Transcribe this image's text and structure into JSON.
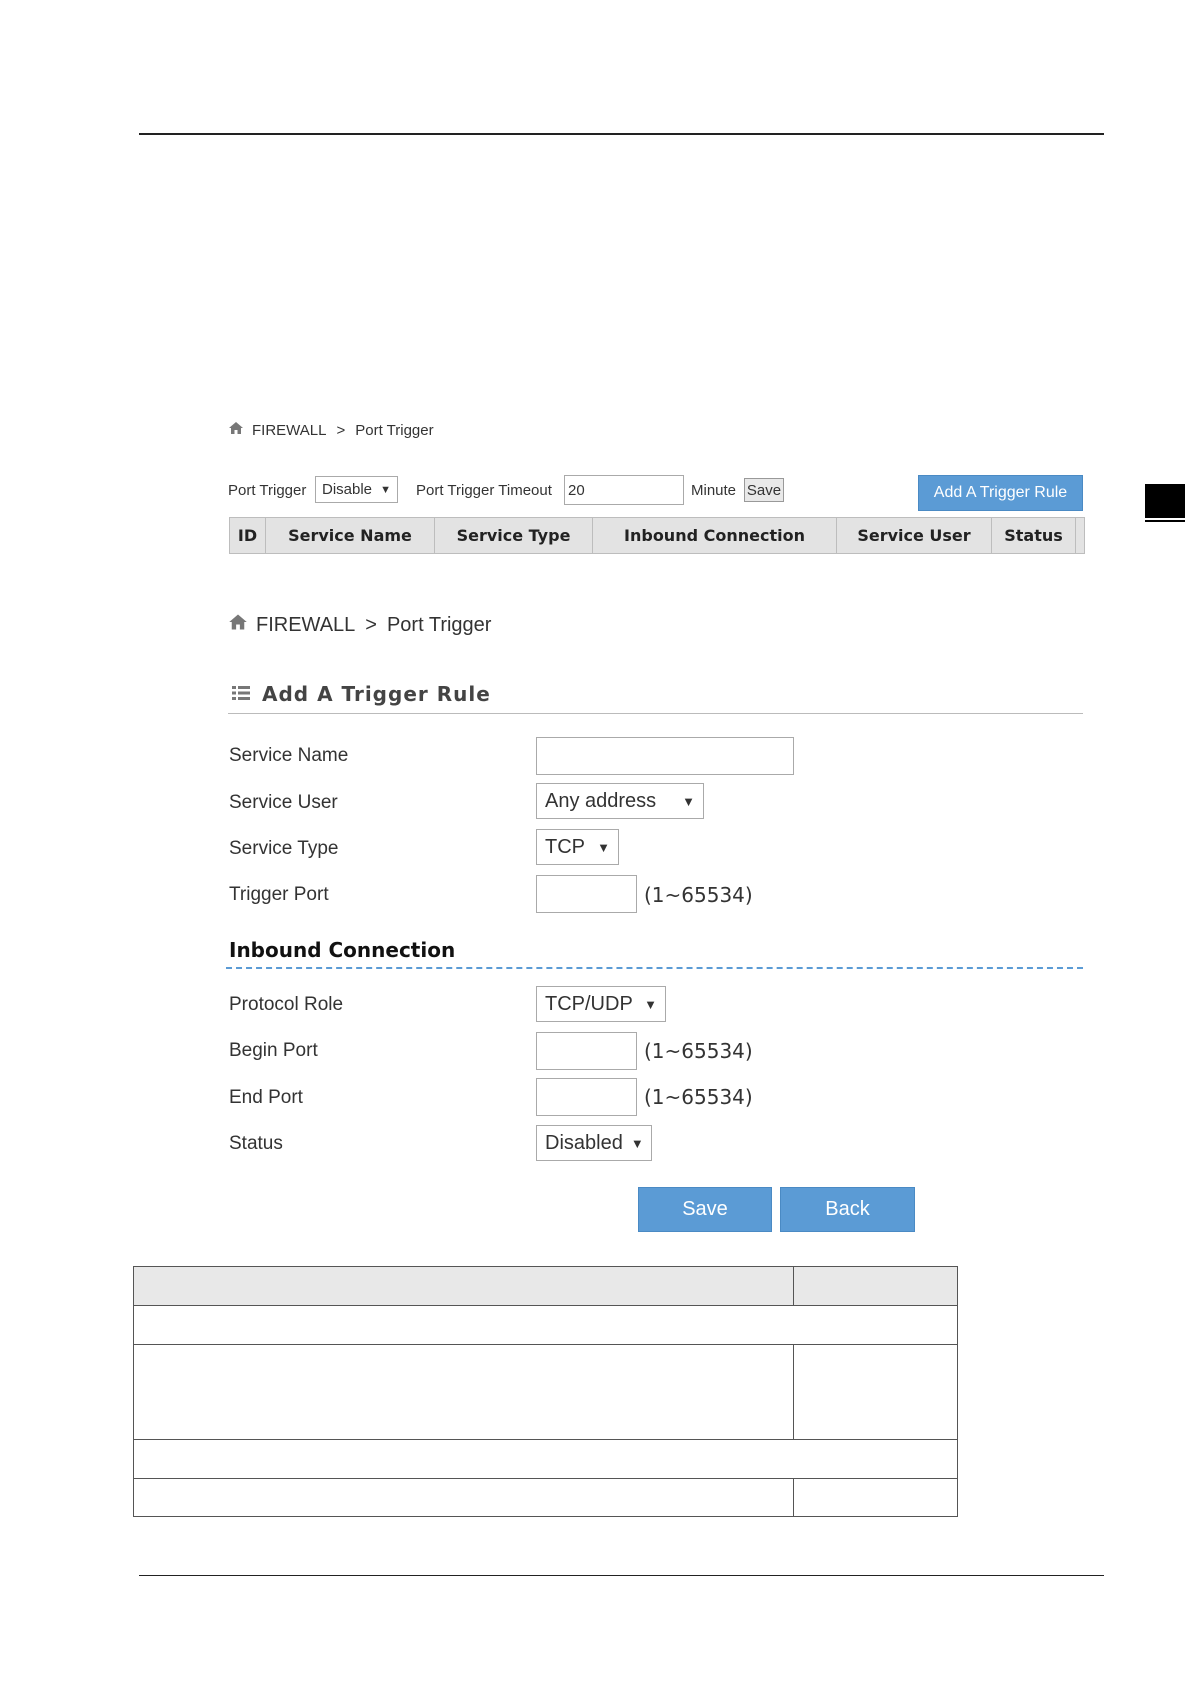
{
  "breadcrumb_small": {
    "section": "FIREWALL",
    "separator": ">",
    "page": "Port Trigger"
  },
  "toolbar": {
    "port_trigger_label": "Port Trigger",
    "port_trigger_value": "Disable",
    "timeout_label": "Port Trigger Timeout",
    "timeout_value": "20",
    "minute_label": "Minute",
    "save_label": "Save",
    "add_rule_label": "Add A Trigger Rule"
  },
  "table_headers": [
    "ID",
    "Service Name",
    "Service Type",
    "Inbound Connection",
    "Service User",
    "Status"
  ],
  "breadcrumb_large": {
    "section": "FIREWALL",
    "separator": ">",
    "page": "Port Trigger"
  },
  "form": {
    "title": "Add A Trigger Rule",
    "service_name_label": "Service Name",
    "service_name_value": "",
    "service_user_label": "Service User",
    "service_user_value": "Any address",
    "service_type_label": "Service Type",
    "service_type_value": "TCP",
    "trigger_port_label": "Trigger Port",
    "trigger_port_range": "(1~65534)",
    "inbound_title": "Inbound Connection",
    "protocol_role_label": "Protocol Role",
    "protocol_role_value": "TCP/UDP",
    "begin_port_label": "Begin Port",
    "begin_port_range": "(1~65534)",
    "end_port_label": "End Port",
    "end_port_range": "(1~65534)",
    "status_label": "Status",
    "status_value": "Disabled",
    "save_label": "Save",
    "back_label": "Back"
  },
  "colors": {
    "accent_blue": "#5b9bd5",
    "header_gray": "#e3e3e3",
    "dashed_blue": "#5b9bd5"
  }
}
